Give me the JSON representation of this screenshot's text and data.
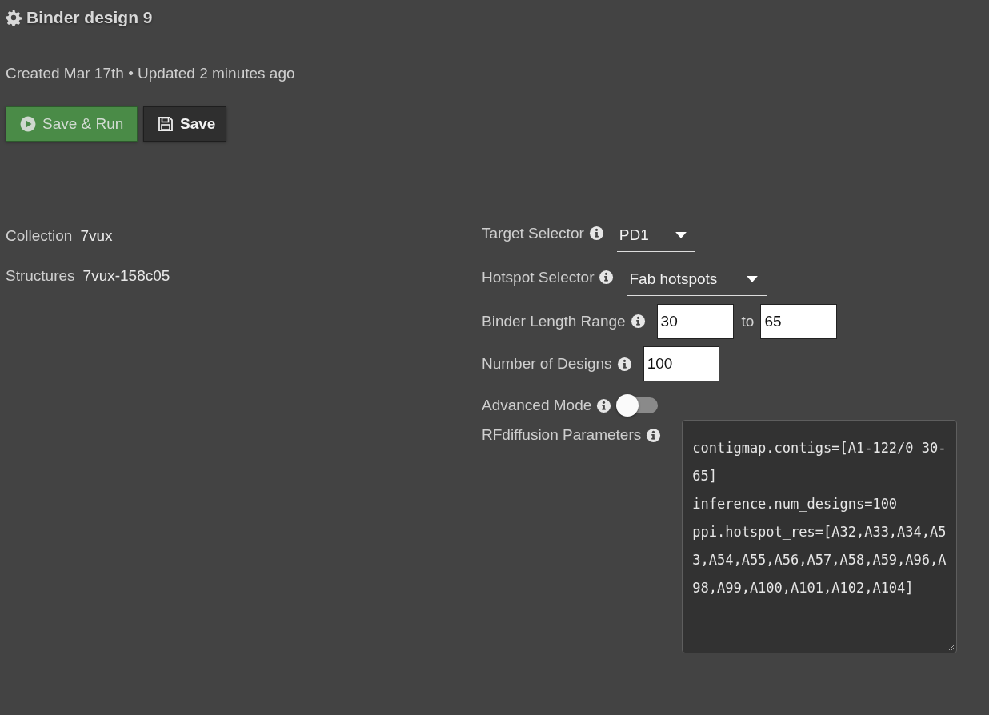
{
  "title": "Binder design 9",
  "meta": "Created Mar 17th • Updated 2 minutes ago",
  "buttons": [
    {
      "kind": "primary",
      "label": "Save & Run"
    },
    {
      "kind": "secondary",
      "label": "Save"
    }
  ],
  "info": [
    {
      "label": "Collection",
      "value": "7vux"
    },
    {
      "label": "Structures",
      "value": "7vux-158c05"
    }
  ],
  "form": [
    {
      "kind": "select",
      "label": "Target Selector",
      "value": "PD1"
    },
    {
      "kind": "select",
      "label": "Hotspot Selector",
      "value": "Fab hotspots"
    },
    {
      "kind": "range",
      "label": "Binder Length Range",
      "value": "30",
      "joiner": "to",
      "value_2": "65"
    },
    {
      "kind": "number",
      "label": "Number of Designs",
      "value": "100"
    },
    {
      "kind": "toggle",
      "label": "Advanced Mode",
      "on": false
    },
    {
      "kind": "textarea",
      "label": "RFdiffusion Parameters",
      "value": "contigmap.contigs=[A1-122/0 30-65]\ninference.num_designs=100\nppi.hotspot_res=[A32,A33,A34,A53,A54,A55,A56,A57,A58,A59,A96,A98,A99,A100,A101,A102,A104]"
    }
  ]
}
